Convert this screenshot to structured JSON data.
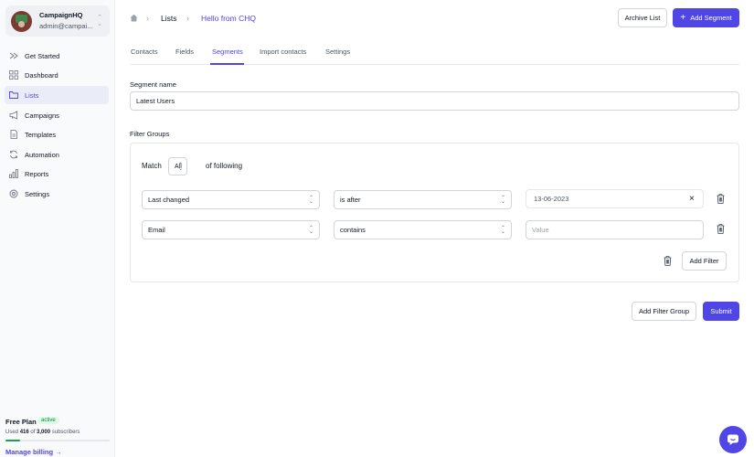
{
  "account": {
    "name": "CampaignHQ",
    "email": "admin@campai..."
  },
  "nav": [
    {
      "label": "Get Started",
      "icon": "rocket-icon"
    },
    {
      "label": "Dashboard",
      "icon": "grid-icon"
    },
    {
      "label": "Lists",
      "icon": "folder-icon",
      "active": true
    },
    {
      "label": "Campaigns",
      "icon": "megaphone-icon"
    },
    {
      "label": "Templates",
      "icon": "document-icon"
    },
    {
      "label": "Automation",
      "icon": "refresh-icon"
    },
    {
      "label": "Reports",
      "icon": "bar-chart-icon"
    },
    {
      "label": "Settings",
      "icon": "gear-icon"
    }
  ],
  "plan": {
    "name": "Free Plan",
    "status": "active",
    "usage_prefix": "Used ",
    "used": "416",
    "usage_mid": " of ",
    "limit": "3,000",
    "usage_suffix": " subscribers",
    "usage_fraction": 0.139,
    "billing_link": "Manage billing →"
  },
  "breadcrumb": {
    "section": "Lists",
    "current": "Hello from CHQ"
  },
  "header_actions": {
    "archive": "Archive List",
    "add_segment": "Add Segment"
  },
  "tabs": [
    "Contacts",
    "Fields",
    "Segments",
    "Import contacts",
    "Settings"
  ],
  "active_tab": "Segments",
  "segment": {
    "label": "Segment name",
    "value": "Latest Users"
  },
  "filter_groups": {
    "label": "Filter Groups",
    "match_prefix": "Match",
    "match_value": "All",
    "match_suffix": "of following",
    "filters": [
      {
        "field": "Last changed",
        "operator": "is after",
        "value": "13-06-2023"
      },
      {
        "field": "Email",
        "operator": "contains",
        "value_placeholder": "Value"
      }
    ],
    "add_filter": "Add Filter"
  },
  "footer_actions": {
    "add_group": "Add Filter Group",
    "submit": "Submit"
  },
  "colors": {
    "accent": "#4f46e5",
    "active_badge_bg": "#dcfce7",
    "active_badge_text": "#15803d",
    "progress": "#16a34a"
  }
}
